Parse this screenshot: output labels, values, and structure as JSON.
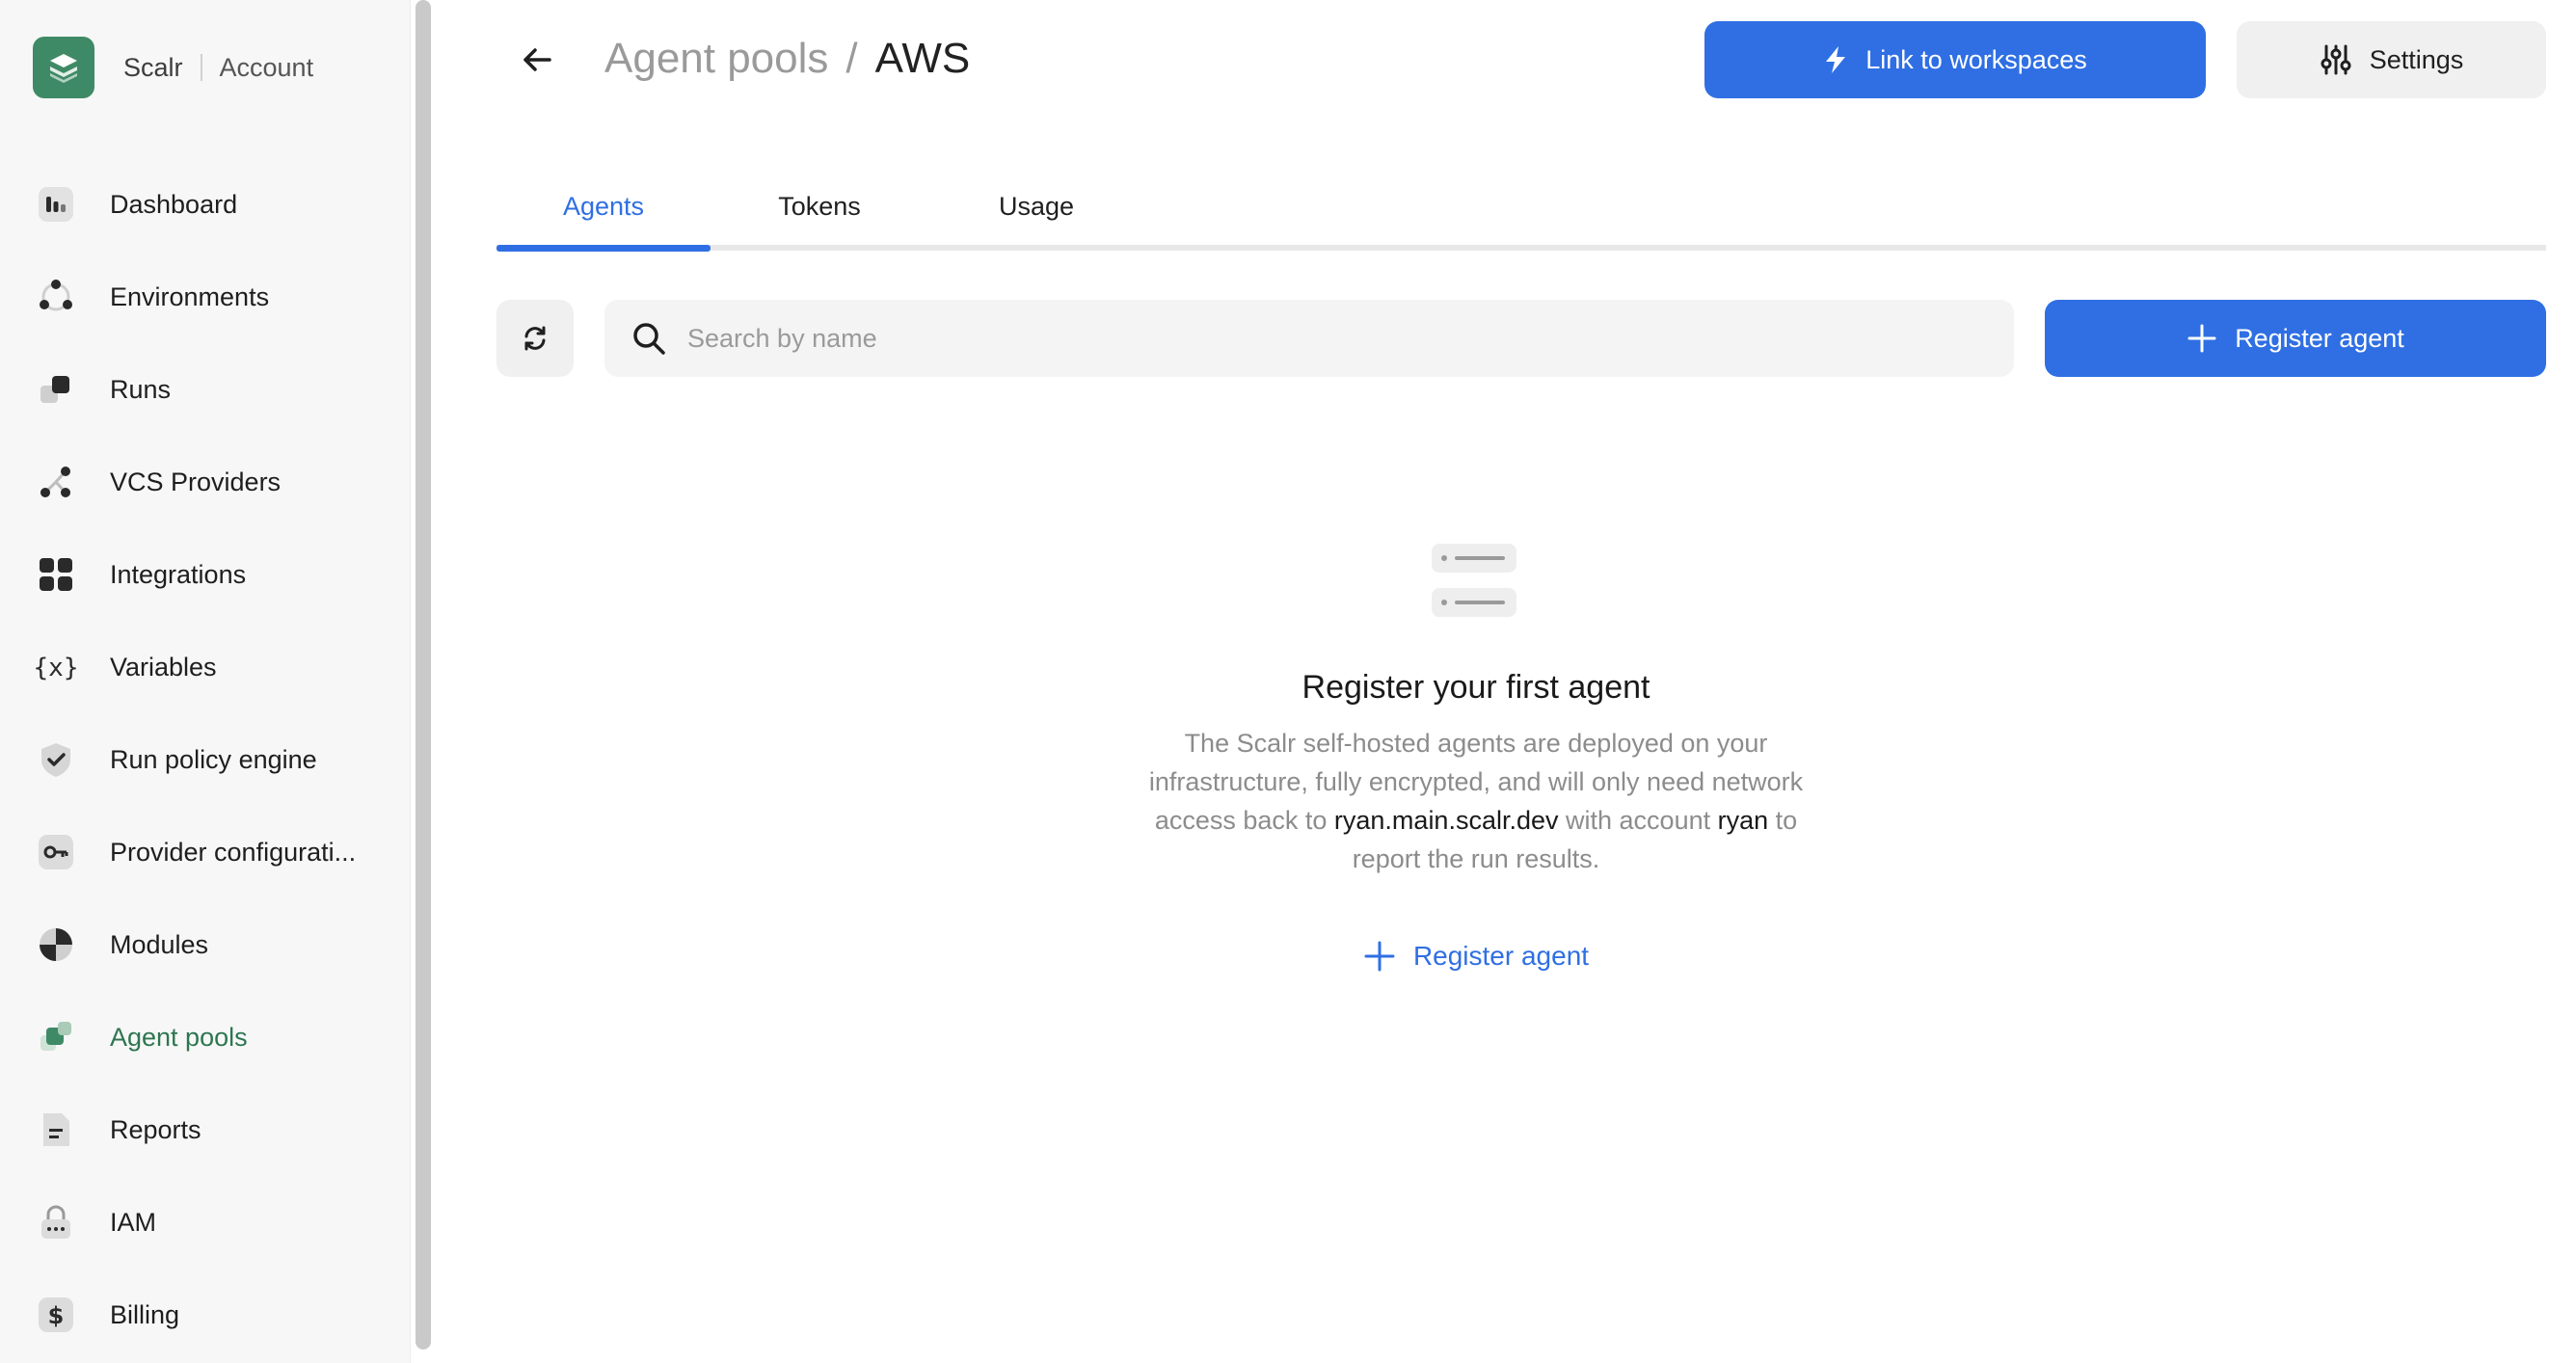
{
  "brand": {
    "name": "Scalr",
    "context": "Account"
  },
  "nav": [
    {
      "id": "dashboard",
      "label": "Dashboard",
      "icon": "dashboard-icon"
    },
    {
      "id": "environments",
      "label": "Environments",
      "icon": "environments-icon"
    },
    {
      "id": "runs",
      "label": "Runs",
      "icon": "runs-icon"
    },
    {
      "id": "vcs",
      "label": "VCS Providers",
      "icon": "vcs-icon"
    },
    {
      "id": "integrations",
      "label": "Integrations",
      "icon": "integrations-icon"
    },
    {
      "id": "variables",
      "label": "Variables",
      "icon": "variables-icon"
    },
    {
      "id": "policy",
      "label": "Run policy engine",
      "icon": "shield-check-icon"
    },
    {
      "id": "provider",
      "label": "Provider configurati...",
      "icon": "key-icon"
    },
    {
      "id": "modules",
      "label": "Modules",
      "icon": "modules-icon"
    },
    {
      "id": "agent-pools",
      "label": "Agent pools",
      "icon": "agent-pools-icon",
      "active": true
    },
    {
      "id": "reports",
      "label": "Reports",
      "icon": "reports-icon"
    },
    {
      "id": "iam",
      "label": "IAM",
      "icon": "lock-icon"
    },
    {
      "id": "billing",
      "label": "Billing",
      "icon": "dollar-icon"
    }
  ],
  "header": {
    "breadcrumb_parent": "Agent pools",
    "breadcrumb_sep": "/",
    "breadcrumb_current": "AWS",
    "link_workspaces_label": "Link to workspaces",
    "settings_label": "Settings"
  },
  "tabs": [
    {
      "label": "Agents",
      "active": true
    },
    {
      "label": "Tokens"
    },
    {
      "label": "Usage"
    }
  ],
  "toolbar": {
    "search_placeholder": "Search by name",
    "register_label": "Register agent"
  },
  "empty_state": {
    "title": "Register your first agent",
    "desc_1": "The Scalr self-hosted agents are deployed on your infrastructure, fully encrypted, and will only need network access back to ",
    "host": "ryan.main.scalr.dev",
    "desc_2": " with account ",
    "account": "ryan",
    "desc_3": " to report the run results.",
    "action_label": "Register agent"
  },
  "colors": {
    "primary": "#2f6fe3",
    "brand_green": "#3f8a66",
    "active_nav": "#2d7650"
  }
}
